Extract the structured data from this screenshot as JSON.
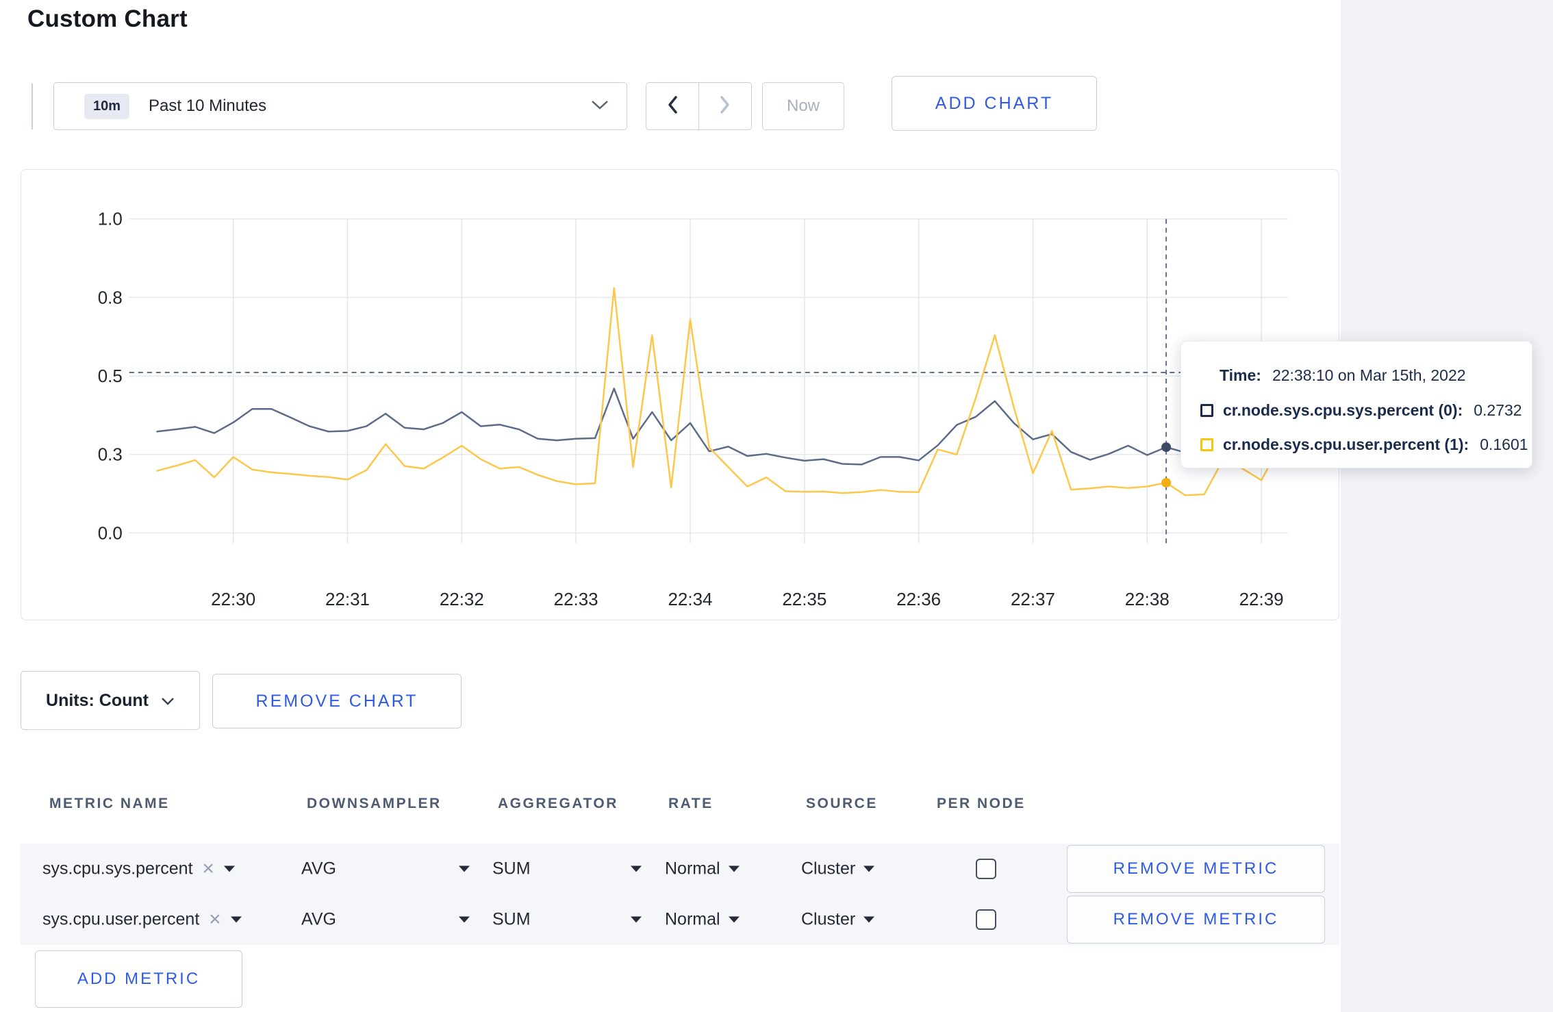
{
  "page": {
    "title": "Custom Chart"
  },
  "colors": {
    "accent_blue": "#2f5ae8",
    "series_sys_line": "#5c6b89",
    "series_user_line": "#fcc74b",
    "tooltip_sys_swatch": "#1b2b4d",
    "tooltip_user_swatch": "#fcc30b",
    "crosshair": "#5f6e8d"
  },
  "toolbar": {
    "time_window_badge": "10m",
    "time_window_label": "Past 10 Minutes",
    "now_label": "Now",
    "add_chart_label": "ADD CHART"
  },
  "chart_data": {
    "type": "line",
    "title": "",
    "ylim": [
      0,
      1
    ],
    "grid": true,
    "legend": "tooltip-only",
    "y_ticks": [
      0,
      0.25,
      0.5,
      0.75,
      1
    ],
    "y_tick_labels": [
      "0.0",
      "0.3",
      "0.5",
      "0.8",
      "1.0"
    ],
    "x_tick_labels": [
      "22:30",
      "22:31",
      "22:32",
      "22:33",
      "22:34",
      "22:35",
      "22:36",
      "22:37",
      "22:38",
      "22:39"
    ],
    "x_start": "22:29:20",
    "x_interval_seconds": 10,
    "series": [
      {
        "name": "cr.node.sys.cpu.sys.percent",
        "color": "#5c6b89",
        "dot_color": "#3e4a63",
        "values": [
          0.323,
          0.33,
          0.338,
          0.318,
          0.352,
          0.395,
          0.395,
          0.368,
          0.34,
          0.323,
          0.325,
          0.34,
          0.38,
          0.335,
          0.33,
          0.35,
          0.385,
          0.34,
          0.345,
          0.33,
          0.3,
          0.295,
          0.3,
          0.302,
          0.46,
          0.3,
          0.385,
          0.295,
          0.35,
          0.26,
          0.275,
          0.245,
          0.252,
          0.24,
          0.23,
          0.235,
          0.22,
          0.218,
          0.242,
          0.242,
          0.231,
          0.279,
          0.344,
          0.37,
          0.42,
          0.35,
          0.298,
          0.315,
          0.258,
          0.233,
          0.252,
          0.278,
          0.248,
          0.2732,
          0.256,
          0.262,
          0.266,
          0.258,
          0.252,
          0.261
        ]
      },
      {
        "name": "cr.node.sys.cpu.user.percent",
        "color": "#fcc74b",
        "dot_color": "#f2ae10",
        "values": [
          0.198,
          0.214,
          0.232,
          0.177,
          0.242,
          0.202,
          0.193,
          0.188,
          0.182,
          0.178,
          0.17,
          0.2,
          0.283,
          0.213,
          0.205,
          0.24,
          0.278,
          0.235,
          0.205,
          0.21,
          0.185,
          0.165,
          0.155,
          0.158,
          0.78,
          0.21,
          0.63,
          0.145,
          0.68,
          0.272,
          0.21,
          0.148,
          0.177,
          0.133,
          0.131,
          0.132,
          0.127,
          0.13,
          0.137,
          0.131,
          0.13,
          0.266,
          0.25,
          0.43,
          0.63,
          0.4,
          0.19,
          0.325,
          0.138,
          0.142,
          0.148,
          0.143,
          0.148,
          0.1601,
          0.12,
          0.123,
          0.235,
          0.205,
          0.168,
          0.28
        ]
      }
    ],
    "crosshair": {
      "index": 53,
      "time": "22:38:10",
      "cursor_value": 0.511,
      "marked_values": [
        0.2732,
        0.1601
      ]
    }
  },
  "tooltip": {
    "time_label": "Time:",
    "time_value": "22:38:10 on Mar 15th, 2022",
    "series": [
      {
        "label": "cr.node.sys.cpu.sys.percent (0):",
        "value": "0.2732"
      },
      {
        "label": "cr.node.sys.cpu.user.percent (1):",
        "value": "0.1601"
      }
    ]
  },
  "units_bar": {
    "units_label": "Units: Count",
    "remove_chart_label": "REMOVE CHART"
  },
  "metrics_table": {
    "headers": [
      "METRIC NAME",
      "DOWNSAMPLER",
      "AGGREGATOR",
      "RATE",
      "SOURCE",
      "PER NODE"
    ],
    "rows": [
      {
        "metric": "sys.cpu.sys.percent",
        "downsampler": "AVG",
        "aggregator": "SUM",
        "rate": "Normal",
        "source": "Cluster",
        "per_node_checked": false,
        "remove_label": "REMOVE METRIC"
      },
      {
        "metric": "sys.cpu.user.percent",
        "downsampler": "AVG",
        "aggregator": "SUM",
        "rate": "Normal",
        "source": "Cluster",
        "per_node_checked": false,
        "remove_label": "REMOVE METRIC"
      }
    ],
    "add_metric_label": "ADD METRIC"
  }
}
